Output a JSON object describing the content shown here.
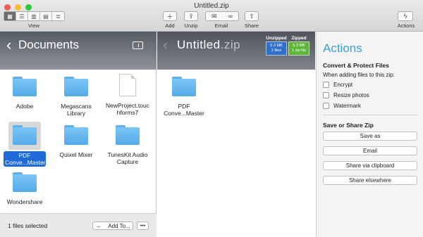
{
  "window": {
    "title": "Untitled.zip"
  },
  "toolbar": {
    "view_label": "View",
    "add_label": "Add",
    "unzip_label": "Unzip",
    "email_label": "Email",
    "share_label": "Share",
    "actions_label": "Actions"
  },
  "left": {
    "title": "Documents",
    "items": [
      {
        "label": "Adobe",
        "icon": "folder-icon"
      },
      {
        "label": "Megascans Library",
        "icon": "folder-icon"
      },
      {
        "label": "NewProject.touchforms7",
        "icon": "document-icon"
      },
      {
        "label": "PDF Conve...Master",
        "icon": "folder-icon"
      },
      {
        "label": "Quixel Mixer",
        "icon": "folder-icon"
      },
      {
        "label": "TunesKit Audio Capture",
        "icon": "folder-icon"
      },
      {
        "label": "Wondershare",
        "icon": "folder-icon"
      }
    ],
    "status": "1 files selected",
    "add_to_label": "Add To...",
    "more_label": "•••"
  },
  "middle": {
    "title_name": "Untitled",
    "title_ext": ".zip",
    "unzipped": {
      "label": "Unzipped",
      "size": "5.3 MB",
      "count": "2 files",
      "color": "#2f6fc7"
    },
    "zipped": {
      "label": "Zipped",
      "size": "5.3 MB",
      "count": "1 zip file",
      "color": "#5fb43c"
    },
    "items": [
      {
        "label": "PDF Conve...Master",
        "icon": "folder-icon"
      }
    ]
  },
  "actions": {
    "title": "Actions",
    "convert_heading": "Convert & Protect Files",
    "adding_text": "When adding files to this zip:",
    "options": [
      {
        "label": "Encrypt",
        "checked": false
      },
      {
        "label": "Resize photos",
        "checked": false
      },
      {
        "label": "Watermark",
        "checked": false
      }
    ],
    "save_heading": "Save or Share Zip",
    "buttons": [
      "Save as",
      "Email",
      "Share via clipboard",
      "Share elsewhere"
    ]
  },
  "colors": {
    "accent": "#3aa0d8",
    "selection": "#1e6ad6",
    "folder": "#6cbcf2"
  }
}
